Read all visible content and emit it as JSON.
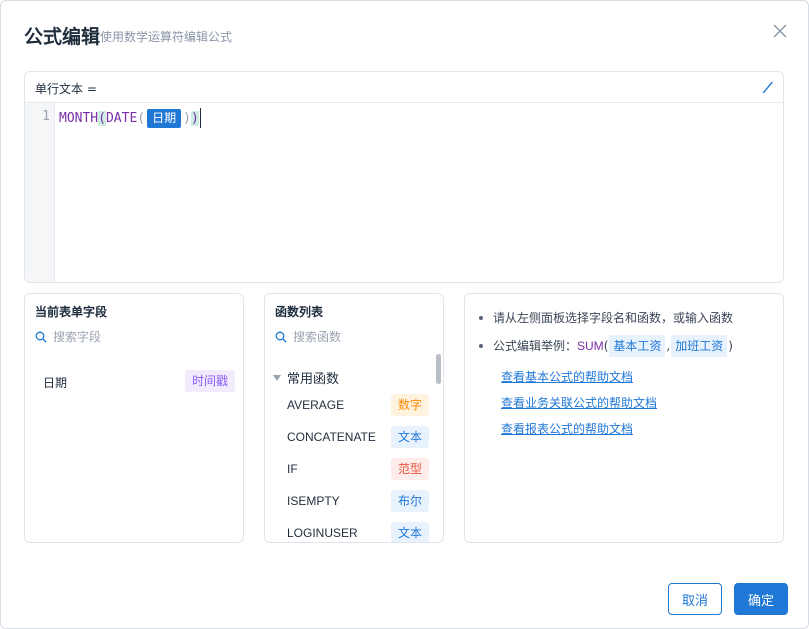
{
  "dialog": {
    "title": "公式编辑",
    "subtitle": "使用数学运算符编辑公式"
  },
  "editor": {
    "label": "单行文本 =",
    "line_number": "1",
    "func_month": "MONTH",
    "func_date": "DATE",
    "field": "日期",
    "paren_open": "(",
    "paren_close": ")",
    "format_icon": "format-icon"
  },
  "fields_panel": {
    "title": "当前表单字段",
    "search_placeholder": "搜索字段",
    "items": [
      {
        "name": "日期",
        "type": "时间戳"
      }
    ]
  },
  "functions_panel": {
    "title": "函数列表",
    "search_placeholder": "搜索函数",
    "group": "常用函数",
    "items": [
      {
        "name": "AVERAGE",
        "type": "数字"
      },
      {
        "name": "CONCATENATE",
        "type": "文本"
      },
      {
        "name": "IF",
        "type": "范型"
      },
      {
        "name": "ISEMPTY",
        "type": "布尔"
      },
      {
        "name": "LOGINUSER",
        "type": "文本"
      }
    ]
  },
  "help_panel": {
    "tip1": "请从左侧面板选择字段名和函数，或输入函数",
    "tip2_prefix": "公式编辑举例：",
    "example_func": "SUM",
    "example_open": "(",
    "example_arg1": "基本工资",
    "example_sep": ",",
    "example_arg2": "加班工资",
    "example_close": ")",
    "links": [
      "查看基本公式的帮助文档",
      "查看业务关联公式的帮助文档",
      "查看报表公式的帮助文档"
    ]
  },
  "footer": {
    "cancel_label": "取消",
    "ok_label": "确定"
  },
  "colors": {
    "accent": "#1f77d6",
    "function_text": "#7a2ea8",
    "tag_number": "#ff8a00",
    "tag_text": "#1f77d6",
    "tag_generic": "#e8563f",
    "tag_timestamp": "#8b5cf6"
  }
}
